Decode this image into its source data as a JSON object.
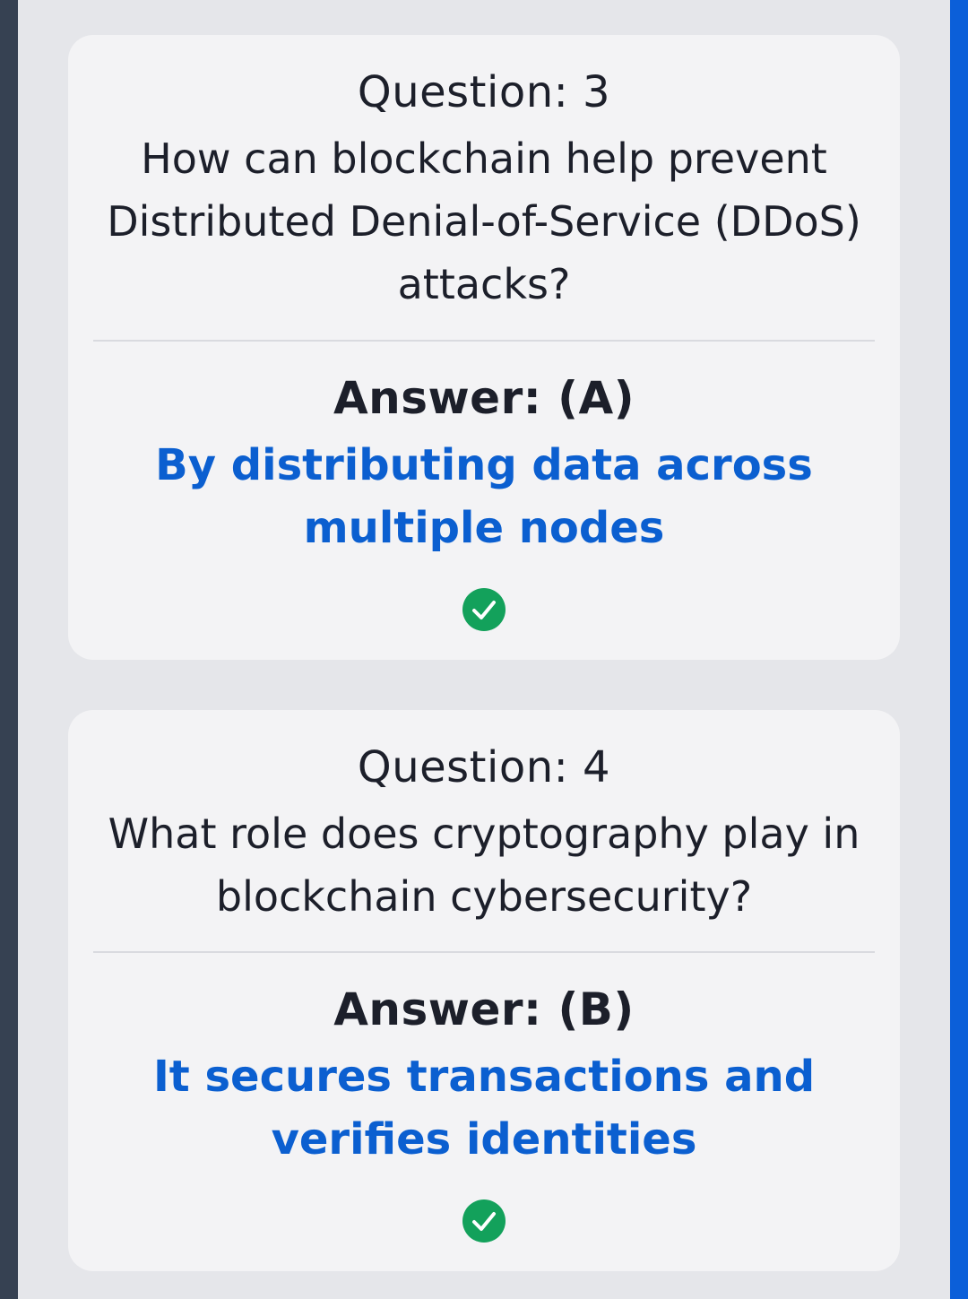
{
  "cards": [
    {
      "question_label": "Question: 3",
      "question_text": "How can blockchain help prevent Distributed Denial-of-Service (DDoS) attacks?",
      "answer_label": "Answer: (A)",
      "answer_text": "By distributing data across multiple nodes",
      "status_icon": "check-circle-icon"
    },
    {
      "question_label": "Question: 4",
      "question_text": "What role does cryptography play in blockchain cybersecurity?",
      "answer_label": "Answer: (B)",
      "answer_text": "It secures transactions and verifies identities",
      "status_icon": "check-circle-icon"
    }
  ],
  "colors": {
    "answer_text": "#0b5fd0",
    "correct_icon": "#13a15b",
    "card_background": "#f3f3f5",
    "page_background": "#e5e6ea",
    "right_accent": "#0b5fd9",
    "left_rail": "#364152"
  }
}
